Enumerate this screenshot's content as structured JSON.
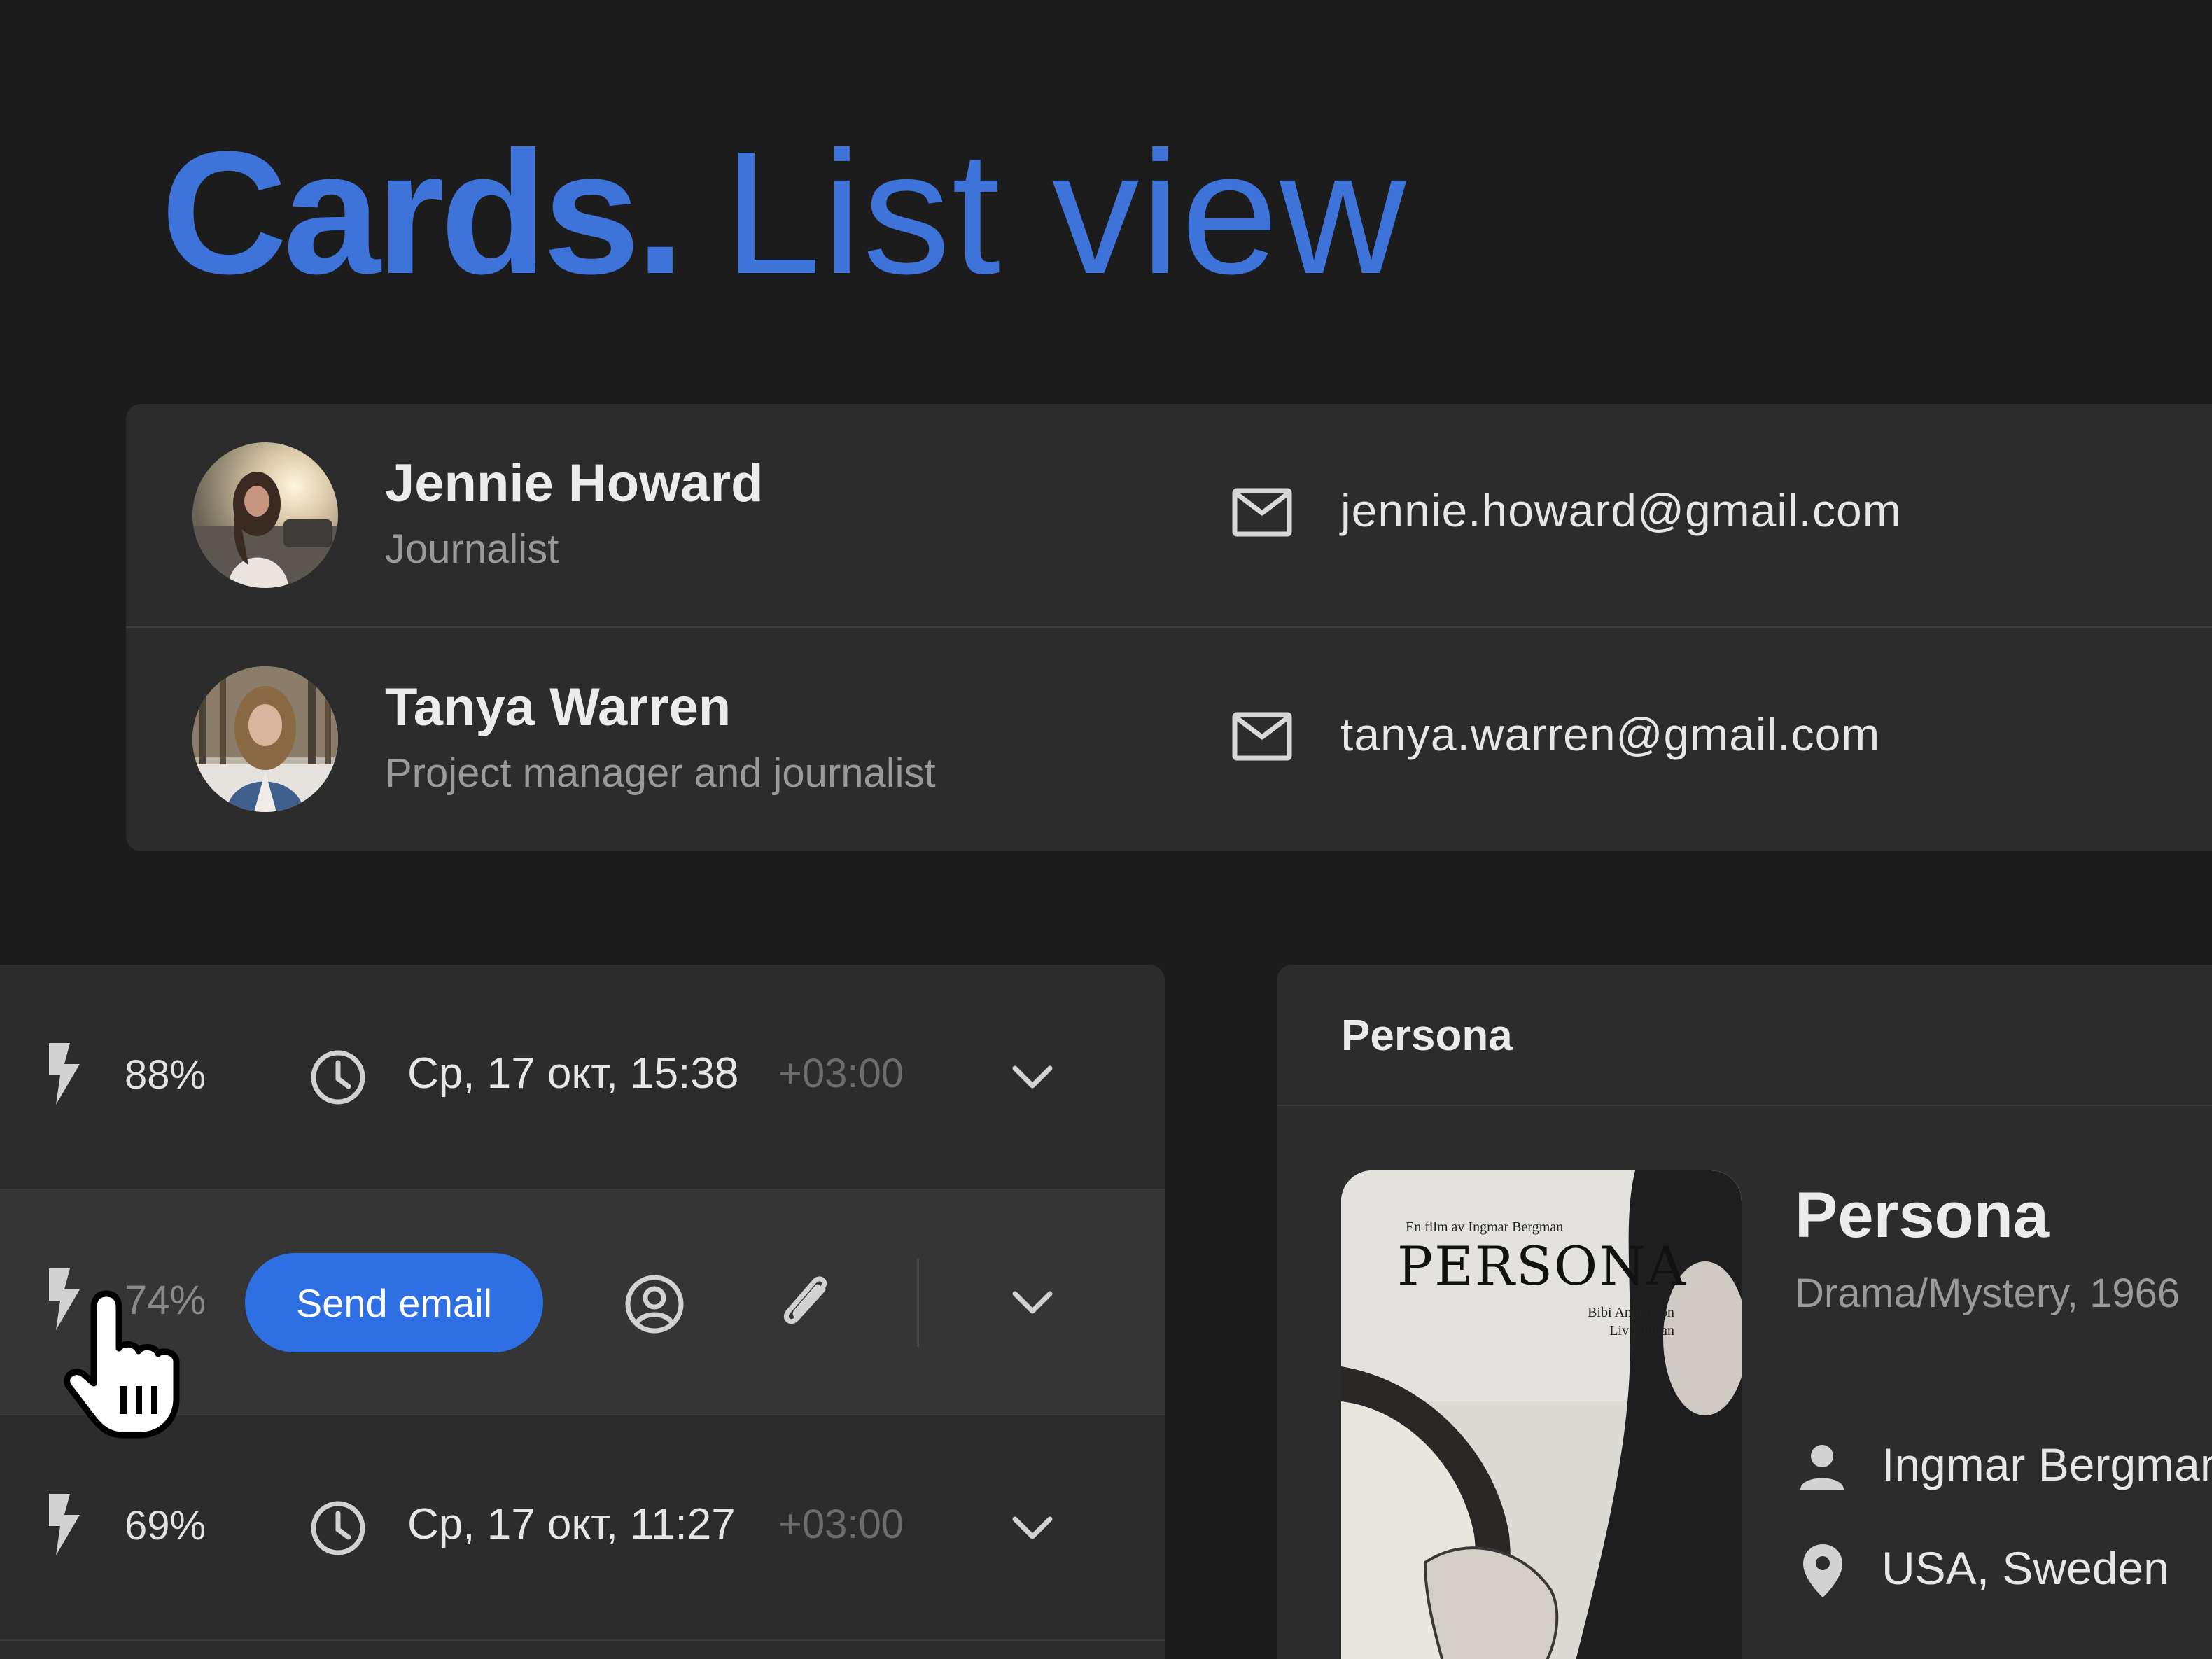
{
  "title": {
    "bold": "Cards.",
    "light": "List view"
  },
  "contacts": [
    {
      "name": "Jennie Howard",
      "role": "Journalist",
      "email": "jennie.howard@gmail.com"
    },
    {
      "name": "Tanya Warren",
      "role": "Project manager and journalist",
      "email": "tanya.warren@gmail.com"
    }
  ],
  "tasks": [
    {
      "percent": "88%",
      "datetime": "Ср, 17 окт, 15:38",
      "timezone": "+03:00"
    },
    {
      "percent": "74%",
      "action_label": "Send email"
    },
    {
      "percent": "69%",
      "datetime": "Ср, 17 окт, 11:27",
      "timezone": "+03:00"
    }
  ],
  "movie": {
    "header": "Persona",
    "title": "Persona",
    "genre_year": "Drama/Mystery, 1966",
    "director": "Ingmar Bergman",
    "countries": "USA, Sweden",
    "poster": {
      "tagline": "En film av Ingmar Bergman",
      "title": "PERSONA",
      "cast": [
        "Bibi Andersson",
        "Liv Ullman"
      ]
    }
  },
  "colors": {
    "accent": "#3e74d9",
    "button": "#2f6fe4",
    "background": "#1c1c1d",
    "card": "#2c2c2d"
  },
  "icons": [
    "mail-icon",
    "bolt-icon",
    "clock-icon",
    "chevron-down-icon",
    "account-circle-icon",
    "paperclip-icon",
    "person-icon",
    "location-pin-icon",
    "hand-cursor-icon"
  ]
}
